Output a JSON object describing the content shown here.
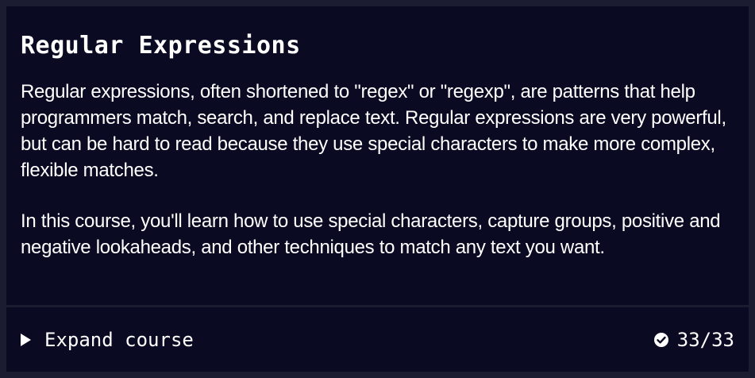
{
  "course": {
    "title": "Regular Expressions",
    "paragraphs": [
      "Regular expressions, often shortened to \"regex\" or \"regexp\", are patterns that help programmers match, search, and replace text. Regular expressions are very powerful, but can be hard to read because they use special characters to make more complex, flexible matches.",
      "In this course, you'll learn how to use special characters, capture groups, positive and negative lookaheads, and other techniques to match any text you want."
    ]
  },
  "footer": {
    "expand_label": "Expand course",
    "expand_icon": "caret-right-icon",
    "progress_icon": "check-circle-icon",
    "progress_text": "33/33"
  },
  "colors": {
    "background": "#0a0a23",
    "frame": "#1b1b32",
    "text": "#ffffff"
  }
}
